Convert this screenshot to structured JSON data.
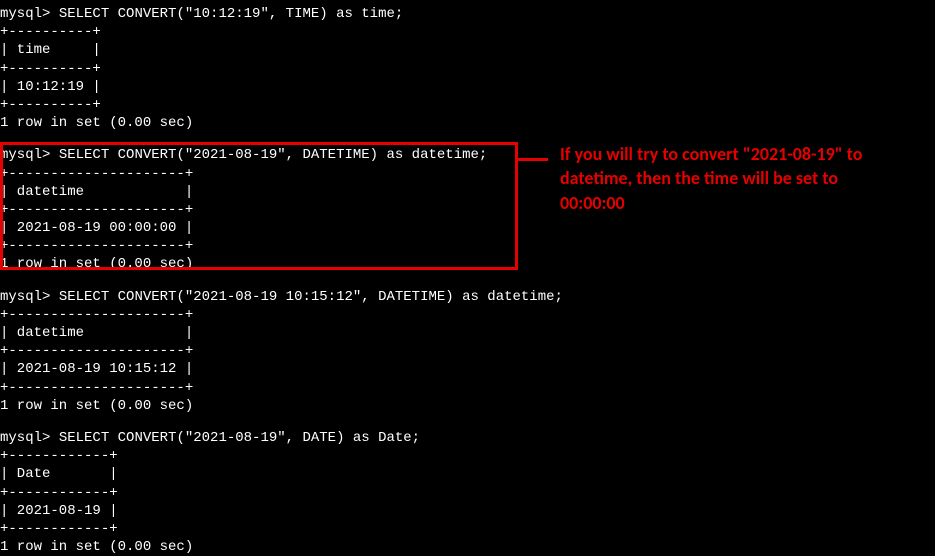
{
  "query1": {
    "prompt": "mysql>",
    "sql": "SELECT CONVERT(\"10:12:19\", TIME) as time;",
    "border1": "+----------+",
    "header": "| time     |",
    "border2": "+----------+",
    "row": "| 10:12:19 |",
    "border3": "+----------+",
    "result": "1 row in set (0.00 sec)"
  },
  "query2": {
    "prompt": "mysql>",
    "sql": "SELECT CONVERT(\"2021-08-19\", DATETIME) as datetime;",
    "border1": "+---------------------+",
    "header": "| datetime            |",
    "border2": "+---------------------+",
    "row": "| 2021-08-19 00:00:00 |",
    "border3": "+---------------------+",
    "result": "1 row in set (0.00 sec)"
  },
  "query3": {
    "prompt": "mysql>",
    "sql": "SELECT CONVERT(\"2021-08-19 10:15:12\", DATETIME) as datetime;",
    "border1": "+---------------------+",
    "header": "| datetime            |",
    "border2": "+---------------------+",
    "row": "| 2021-08-19 10:15:12 |",
    "border3": "+---------------------+",
    "result": "1 row in set (0.00 sec)"
  },
  "query4": {
    "prompt": "mysql>",
    "sql": "SELECT CONVERT(\"2021-08-19\", DATE) as Date;",
    "border1": "+------------+",
    "header": "| Date       |",
    "border2": "+------------+",
    "row": "| 2021-08-19 |",
    "border3": "+------------+",
    "result": "1 row in set (0.00 sec)"
  },
  "annotation": {
    "text": "If you will try to convert \"2021-08-19\" to datetime, then the time will be set to 00:00:00"
  }
}
